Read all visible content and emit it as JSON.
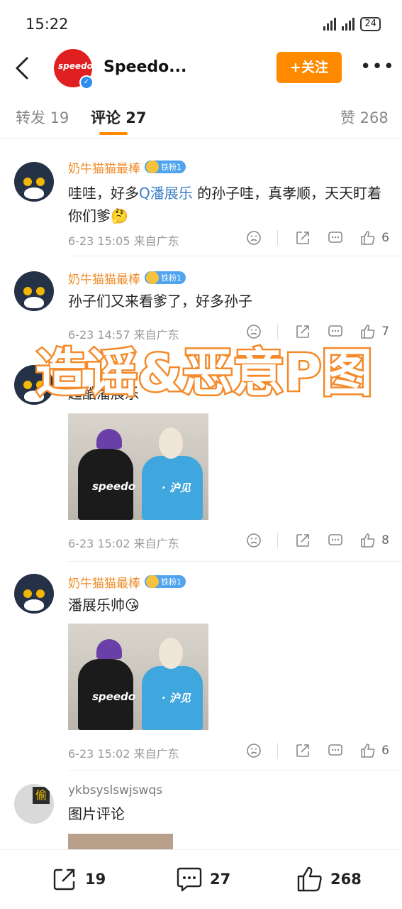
{
  "status": {
    "time": "15:22",
    "battery": "24"
  },
  "header": {
    "brand": "Speedo...",
    "brand_logo": "speedo",
    "follow_label": "+关注",
    "more": "•••"
  },
  "tabs": {
    "repost": "转发 19",
    "comment": "评论 27",
    "like": "赞 268"
  },
  "overlay": {
    "text": "造谣&恶意P图",
    "color": "#f48a2a"
  },
  "comments": [
    {
      "name": "奶牛猫猫最棒",
      "badge": "铁粉1",
      "text_before": "哇哇，好多",
      "mention": "Q潘展乐",
      "text_after": " 的孙子哇，真孝顺，天天盯着你们爹🤔",
      "meta": "6-23 15:05 来自广东",
      "likes": "6"
    },
    {
      "name": "奶牛猫猫最棒",
      "badge": "铁粉1",
      "text": "孙子们又来看爹了，好多孙子",
      "meta": "6-23 14:57 来自广东",
      "likes": "7"
    },
    {
      "name": "",
      "text": "超酷潘展乐",
      "image_brand": "speedo",
      "image_caption": "· 沪见",
      "meta": "6-23 15:02 来自广东",
      "likes": "8"
    },
    {
      "name": "奶牛猫猫最棒",
      "badge": "铁粉1",
      "text": "潘展乐帅😘",
      "image_brand": "speedo",
      "image_caption": "· 沪见",
      "meta": "6-23 15:02 来自广东",
      "likes": "6"
    },
    {
      "name": "ykbsyslswjswqs",
      "avatar_text": "偷",
      "text": "图片评论"
    }
  ],
  "bottom": {
    "repost": "19",
    "comment": "27",
    "like": "268"
  }
}
